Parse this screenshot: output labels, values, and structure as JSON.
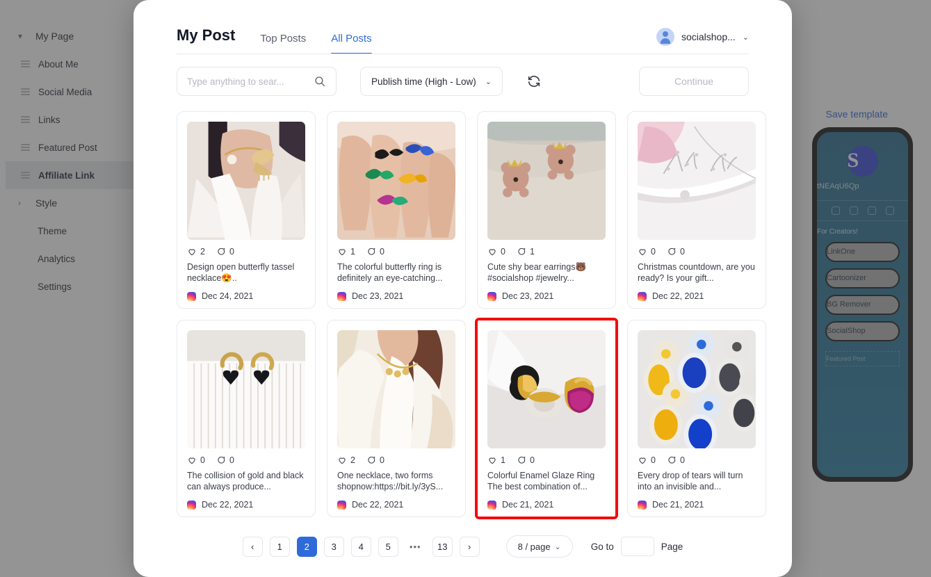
{
  "background": {
    "sidebar": {
      "items": [
        {
          "label": "My Page",
          "icon": "chevron-down-icon",
          "state": "group-open"
        },
        {
          "label": "About Me",
          "icon": "drag-handle-icon",
          "state": "normal"
        },
        {
          "label": "Social Media",
          "icon": "drag-handle-icon",
          "state": "normal"
        },
        {
          "label": "Links",
          "icon": "drag-handle-icon",
          "state": "normal"
        },
        {
          "label": "Featured Post",
          "icon": "drag-handle-icon",
          "state": "normal"
        },
        {
          "label": "Affiliate Link",
          "icon": "drag-handle-icon",
          "state": "active"
        },
        {
          "label": "Style",
          "icon": "chevron-right-icon",
          "state": "group-closed"
        },
        {
          "label": "Theme",
          "icon": "none",
          "state": "normal"
        },
        {
          "label": "Analytics",
          "icon": "none",
          "state": "normal"
        },
        {
          "label": "Settings",
          "icon": "none",
          "state": "normal"
        }
      ]
    },
    "save_template_label": "Save template",
    "phone_preview": {
      "logo_letter": "S",
      "handle": "tNEAqU6Qp",
      "tagline": "For Creators!",
      "buttons": [
        "LinkOne",
        "Cartoonizer",
        "BG Remover",
        "SocialShop"
      ],
      "featured_label": "Featured Post"
    }
  },
  "modal": {
    "tabs": [
      {
        "label": "My Post",
        "type": "title",
        "active": false
      },
      {
        "label": "Top Posts",
        "type": "tab",
        "active": false
      },
      {
        "label": "All Posts",
        "type": "tab",
        "active": true
      }
    ],
    "account": {
      "name": "socialshop...",
      "caret": "⌄"
    },
    "toolbar": {
      "search_placeholder": "Type anything to sear...",
      "search_value": "",
      "sort_value": "Publish time (High - Low)",
      "sort_caret": "⌄",
      "refresh_label": "refresh-icon",
      "continue_label": "Continue"
    },
    "posts": [
      {
        "caption": "Design open butterfly tassel necklace😍..",
        "likes": "2",
        "comments": "0",
        "date": "Dec 24, 2021",
        "image": "butterfly-tassel-necklace",
        "selected": false
      },
      {
        "caption": "The colorful butterfly ring is definitely an eye-catching...",
        "likes": "1",
        "comments": "0",
        "date": "Dec 23, 2021",
        "image": "colorful-butterfly-rings",
        "selected": false
      },
      {
        "caption": "Cute shy bear earrings🐻 #socialshop #jewelry...",
        "likes": "0",
        "comments": "1",
        "date": "Dec 23, 2021",
        "image": "bear-earrings",
        "selected": false
      },
      {
        "caption": "Christmas countdown, are you ready? Is your gift...",
        "likes": "0",
        "comments": "0",
        "date": "Dec 22, 2021",
        "image": "silver-antler-necklace",
        "selected": false
      },
      {
        "caption": "The collision of gold and black can always produce...",
        "likes": "0",
        "comments": "0",
        "date": "Dec 22, 2021",
        "image": "black-heart-earrings",
        "selected": false
      },
      {
        "caption": "One necklace, two forms shopnow:https://bit.ly/3yS...",
        "likes": "2",
        "comments": "0",
        "date": "Dec 22, 2021",
        "image": "gold-necklace-white-blazer",
        "selected": false
      },
      {
        "caption": "Colorful Enamel Glaze Ring The best combination of...",
        "likes": "1",
        "comments": "0",
        "date": "Dec 21, 2021",
        "image": "enamel-glaze-rings",
        "selected": true
      },
      {
        "caption": "Every drop of tears will turn into an invisible and...",
        "likes": "0",
        "comments": "0",
        "date": "Dec 21, 2021",
        "image": "teardrop-crystal-earrings",
        "selected": false
      }
    ],
    "pagination": {
      "prev": "‹",
      "next": "›",
      "pages": [
        "1",
        "2",
        "3",
        "4",
        "5",
        "•••",
        "13"
      ],
      "current": "2",
      "per_page": "8 / page",
      "per_page_caret": "⌄",
      "goto_prefix": "Go to",
      "goto_value": "",
      "goto_suffix": "Page"
    }
  },
  "colors": {
    "accent": "#2f6bd8",
    "selection": "#f50b0b",
    "text": "#2c2c3a",
    "muted": "#b6b9c1",
    "border": "#e4e6ea"
  }
}
